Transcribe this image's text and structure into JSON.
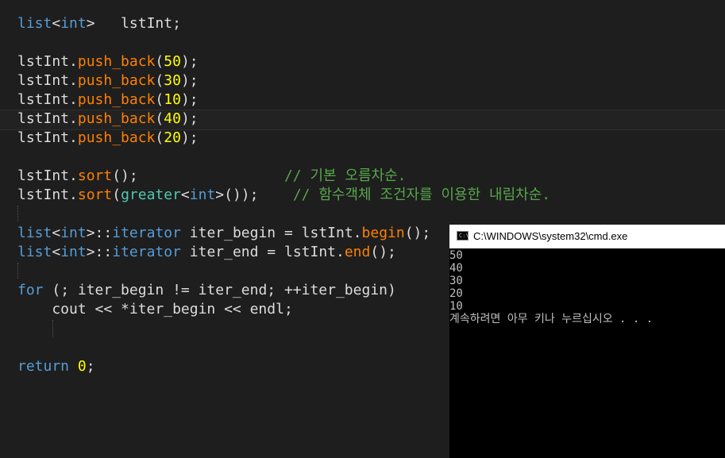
{
  "editor": {
    "lines": [
      [
        {
          "t": "list",
          "c": "kw"
        },
        {
          "t": "<",
          "c": "tx"
        },
        {
          "t": "int",
          "c": "kw"
        },
        {
          "t": ">   lstInt;",
          "c": "tx"
        }
      ],
      [],
      [
        {
          "t": "lstInt.",
          "c": "tx"
        },
        {
          "t": "push_back",
          "c": "fn"
        },
        {
          "t": "(",
          "c": "tx"
        },
        {
          "t": "50",
          "c": "num"
        },
        {
          "t": ");",
          "c": "tx"
        }
      ],
      [
        {
          "t": "lstInt.",
          "c": "tx"
        },
        {
          "t": "push_back",
          "c": "fn"
        },
        {
          "t": "(",
          "c": "tx"
        },
        {
          "t": "30",
          "c": "num"
        },
        {
          "t": ");",
          "c": "tx"
        }
      ],
      [
        {
          "t": "lstInt.",
          "c": "tx"
        },
        {
          "t": "push_back",
          "c": "fn"
        },
        {
          "t": "(",
          "c": "tx"
        },
        {
          "t": "10",
          "c": "num"
        },
        {
          "t": ");",
          "c": "tx"
        }
      ],
      [
        {
          "t": "lstInt.",
          "c": "tx"
        },
        {
          "t": "push_back",
          "c": "fn"
        },
        {
          "t": "(",
          "c": "tx"
        },
        {
          "t": "40",
          "c": "num"
        },
        {
          "t": ");",
          "c": "tx"
        }
      ],
      [
        {
          "t": "lstInt.",
          "c": "tx"
        },
        {
          "t": "push_back",
          "c": "fn"
        },
        {
          "t": "(",
          "c": "tx"
        },
        {
          "t": "20",
          "c": "num"
        },
        {
          "t": ");",
          "c": "tx"
        }
      ],
      [],
      [
        {
          "t": "lstInt.",
          "c": "tx"
        },
        {
          "t": "sort",
          "c": "fn"
        },
        {
          "t": "();                 ",
          "c": "tx"
        },
        {
          "t": "// 기본 오름차순.",
          "c": "cm"
        }
      ],
      [
        {
          "t": "lstInt.",
          "c": "tx"
        },
        {
          "t": "sort",
          "c": "fn"
        },
        {
          "t": "(",
          "c": "tx"
        },
        {
          "t": "greater",
          "c": "ty"
        },
        {
          "t": "<",
          "c": "tx"
        },
        {
          "t": "int",
          "c": "kw"
        },
        {
          "t": ">());    ",
          "c": "tx"
        },
        {
          "t": "// 함수객체 조건자를 이용한 내림차순.",
          "c": "cm"
        }
      ],
      [],
      [
        {
          "t": "list",
          "c": "kw"
        },
        {
          "t": "<",
          "c": "tx"
        },
        {
          "t": "int",
          "c": "kw"
        },
        {
          "t": ">::",
          "c": "tx"
        },
        {
          "t": "iterator",
          "c": "kw"
        },
        {
          "t": " iter_begin = lstInt.",
          "c": "tx"
        },
        {
          "t": "begin",
          "c": "fn"
        },
        {
          "t": "();",
          "c": "tx"
        }
      ],
      [
        {
          "t": "list",
          "c": "kw"
        },
        {
          "t": "<",
          "c": "tx"
        },
        {
          "t": "int",
          "c": "kw"
        },
        {
          "t": ">::",
          "c": "tx"
        },
        {
          "t": "iterator",
          "c": "kw"
        },
        {
          "t": " iter_end = lstInt.",
          "c": "tx"
        },
        {
          "t": "end",
          "c": "fn"
        },
        {
          "t": "();",
          "c": "tx"
        }
      ],
      [],
      [
        {
          "t": "for",
          "c": "kw"
        },
        {
          "t": " (; iter_begin != iter_end; ++iter_begin)",
          "c": "tx"
        }
      ],
      [
        {
          "t": "    cout << *iter_begin << endl;",
          "c": "tx"
        }
      ],
      [],
      [],
      [
        {
          "t": "return",
          "c": "kw"
        },
        {
          "t": " ",
          "c": "tx"
        },
        {
          "t": "0",
          "c": "num"
        },
        {
          "t": ";",
          "c": "tx"
        }
      ]
    ]
  },
  "console": {
    "title": "C:\\WINDOWS\\system32\\cmd.exe",
    "icon": "cmd-icon",
    "output": [
      "50",
      "40",
      "30",
      "20",
      "10",
      "계속하려면 아무 키나 누르십시오 . . ."
    ]
  },
  "colors": {
    "keyword": "#569cd6",
    "type": "#4ec9b0",
    "function": "#ff8000",
    "number": "#ffff00",
    "comment": "#57a64a",
    "text": "#dcdcdc",
    "editor_bg": "#1e1e1e",
    "console_bg": "#000000"
  }
}
